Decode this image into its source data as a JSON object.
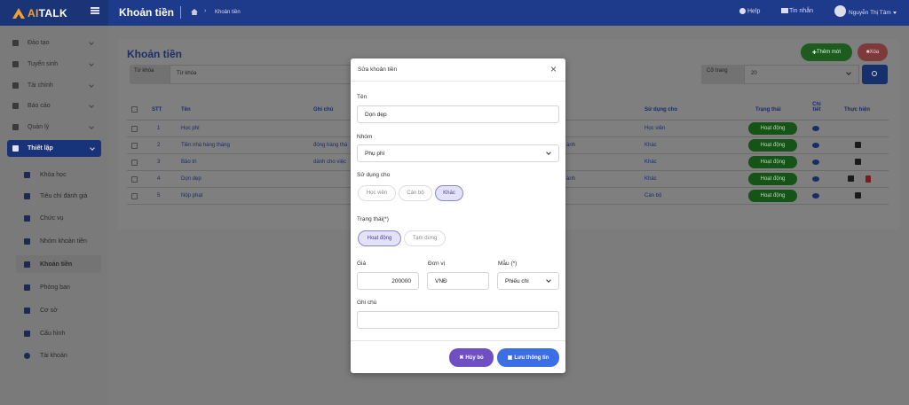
{
  "topbar": {
    "logo_prefix": "AI",
    "logo_suffix": "TALK",
    "title": "Khoản tiền",
    "breadcrumb": "Khoản tiền",
    "help": "Help",
    "messages": "Tin nhắn",
    "user": "Nguyễn Thị Tâm"
  },
  "sidebar": {
    "items": [
      {
        "label": "Đào tạo"
      },
      {
        "label": "Tuyển sinh"
      },
      {
        "label": "Tài chính"
      },
      {
        "label": "Báo cáo"
      },
      {
        "label": "Quản lý"
      },
      {
        "label": "Thiết lập"
      }
    ],
    "sub_items": [
      {
        "label": "Khóa học"
      },
      {
        "label": "Tiêu chí đánh giá"
      },
      {
        "label": "Chức vụ"
      },
      {
        "label": "Nhóm khoản tiền"
      },
      {
        "label": "Khoản tiền"
      },
      {
        "label": "Phòng ban"
      },
      {
        "label": "Cơ sở"
      },
      {
        "label": "Cấu hình"
      },
      {
        "label": "Tài khoản"
      }
    ]
  },
  "page": {
    "heading": "Khoản tiền",
    "add_button": "Thêm mới",
    "delete_button": "Xóa",
    "keyword_label": "Từ khóa",
    "keyword_placeholder": "Từ khóa",
    "page_size_label": "Cỡ trang",
    "page_size_value": "20"
  },
  "table": {
    "headers": [
      "STT",
      "Tên",
      "Ghi chú",
      "Sử dụng cho",
      "Trạng thái",
      "Chi tiết",
      "Thực hiện"
    ],
    "rows": [
      {
        "stt": "1",
        "name": "Học phí",
        "note": "",
        "group": "",
        "usage": "Học viên",
        "status": "Hoạt động"
      },
      {
        "stt": "2",
        "name": "Tiền nhà hàng tháng",
        "note": "đóng hàng thá",
        "group": "ành",
        "usage": "Khác",
        "status": "Hoạt động"
      },
      {
        "stt": "3",
        "name": "Bảo trì",
        "note": "dành cho việc",
        "group": "",
        "usage": "Khác",
        "status": "Hoạt động"
      },
      {
        "stt": "4",
        "name": "Dọn dẹp",
        "note": "",
        "group": "ành",
        "usage": "Khác",
        "status": "Hoạt động"
      },
      {
        "stt": "5",
        "name": "Nộp phạt",
        "note": "",
        "group": "",
        "usage": "Cán bộ",
        "status": "Hoạt động"
      }
    ]
  },
  "modal": {
    "title": "Sửa khoản tiền",
    "name_label": "Tên",
    "name_value": "Dọn dẹp",
    "group_label": "Nhóm",
    "group_value": "Phụ phí",
    "usage_label": "Sử dụng cho",
    "usage_options": [
      "Học viên",
      "Cán bộ",
      "Khác"
    ],
    "status_label": "Trạng thái(*)",
    "status_options": [
      "Hoạt động",
      "Tạm dừng"
    ],
    "price_label": "Giá",
    "price_value": "200000",
    "unit_label": "Đơn vị",
    "unit_value": "VNĐ",
    "template_label": "Mẫu (*)",
    "template_value": "Phiếu chi",
    "note_label": "Ghi chú",
    "note_value": "",
    "cancel_button": "Hủy bỏ",
    "save_button": "Lưu thông tin"
  },
  "colors": {
    "topbar": "#1e3a8a",
    "logo_accent": "#f0a32a",
    "status_active": "#165316",
    "cancel_button": "#6e4fc4",
    "save_button": "#3c6fe6",
    "pill_selected": "#e4e2f8"
  }
}
